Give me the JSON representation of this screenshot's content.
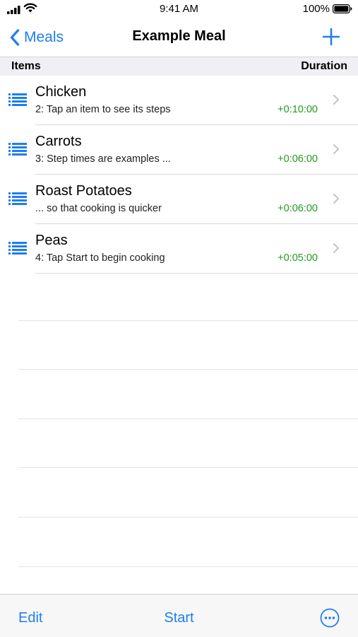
{
  "status": {
    "time": "9:41 AM",
    "battery_pct": "100%"
  },
  "nav": {
    "back_label": "Meals",
    "title": "Example Meal"
  },
  "section": {
    "left": "Items",
    "right": "Duration"
  },
  "items": [
    {
      "title": "Chicken",
      "subtitle": "2: Tap an item to see its steps",
      "duration": "+0:10:00"
    },
    {
      "title": "Carrots",
      "subtitle": "3: Step times are examples ...",
      "duration": "+0:06:00"
    },
    {
      "title": "Roast Potatoes",
      "subtitle": "... so that cooking is quicker",
      "duration": "+0:06:00"
    },
    {
      "title": "Peas",
      "subtitle": "4: Tap Start to begin cooking",
      "duration": "+0:05:00"
    }
  ],
  "toolbar": {
    "edit_label": "Edit",
    "start_label": "Start"
  },
  "colors": {
    "accent": "#1e7df5",
    "duration": "#1e9b1e",
    "section_bg": "#efeff4"
  },
  "icons": {
    "row": "list-icon",
    "more": "ellipsis-circle-icon",
    "add": "plus-icon",
    "back": "chevron-left-icon",
    "disclosure": "chevron-right-icon"
  }
}
